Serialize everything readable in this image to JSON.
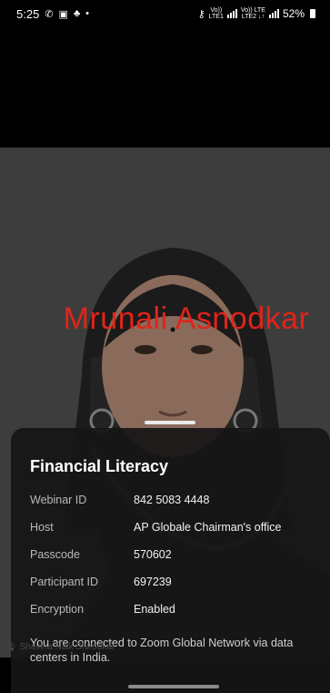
{
  "status_bar": {
    "time": "5:25",
    "battery": "52%",
    "net1_top": "Vo))",
    "net1_bottom": "LTE1",
    "net2_top": "Vo)) LTE",
    "net2_bottom": "LTE2 ↓↑"
  },
  "video": {
    "participant_name": "Mrunali Asnodkar",
    "speaker_label": "Shavina Naik Shirodkar"
  },
  "meeting_info": {
    "title": "Financial Literacy",
    "rows": [
      {
        "label": "Webinar ID",
        "value": "842 5083 4448"
      },
      {
        "label": "Host",
        "value": "AP Globale Chairman's office"
      },
      {
        "label": "Passcode",
        "value": "570602"
      },
      {
        "label": "Participant ID",
        "value": "697239"
      },
      {
        "label": "Encryption",
        "value": "Enabled"
      }
    ],
    "network_note": "You are connected to Zoom Global Network via data centers in India."
  }
}
